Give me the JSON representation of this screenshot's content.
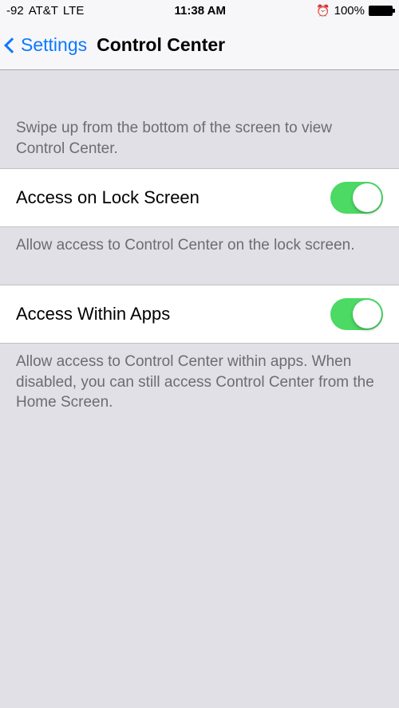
{
  "statusBar": {
    "signal": "-92",
    "carrier": "AT&T",
    "network": "LTE",
    "time": "11:38 AM",
    "battery": "100%"
  },
  "nav": {
    "backLabel": "Settings",
    "title": "Control Center"
  },
  "sections": {
    "introText": "Swipe up from the bottom of the screen to view Control Center.",
    "lockScreen": {
      "label": "Access on Lock Screen",
      "footer": "Allow access to Control Center on the lock screen.",
      "on": true
    },
    "withinApps": {
      "label": "Access Within Apps",
      "footer": "Allow access to Control Center within apps. When disabled, you can still access Control Center from the Home Screen.",
      "on": true
    }
  }
}
